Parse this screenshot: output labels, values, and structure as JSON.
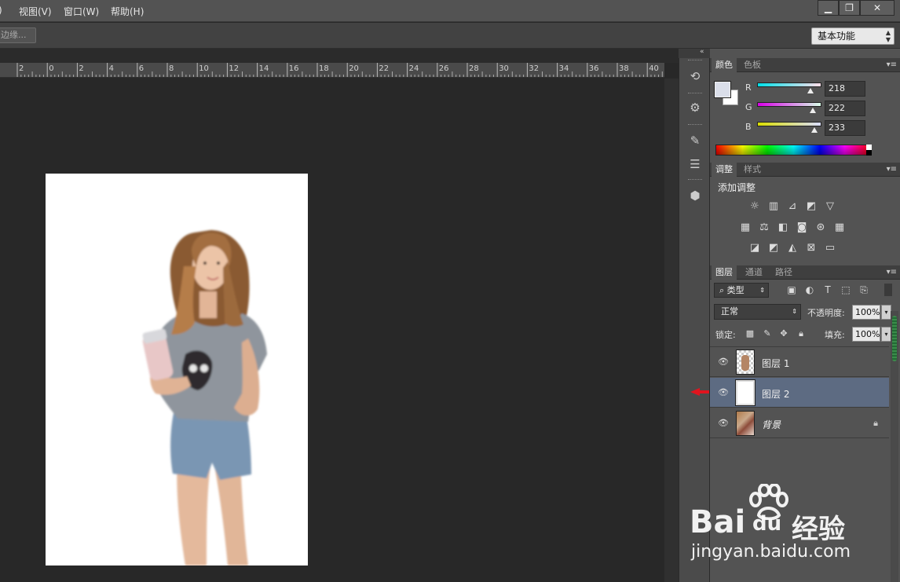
{
  "menu": {
    "items": [
      ")",
      "视图(V)",
      "窗口(W)",
      "帮助(H)"
    ],
    "window_buttons": [
      "minimize-icon",
      "restore-icon",
      "close-icon"
    ]
  },
  "options": {
    "edge_button": "边缘...",
    "workspace": "基本功能"
  },
  "ruler": {
    "labels": [
      "2",
      "0",
      "2",
      "4",
      "6",
      "8",
      "10",
      "12",
      "14",
      "16",
      "18",
      "20",
      "22",
      "24",
      "26",
      "28",
      "30",
      "32",
      "34",
      "36",
      "38",
      "40"
    ]
  },
  "color_panel": {
    "tabs": [
      "颜色",
      "色板"
    ],
    "r_label": "R",
    "g_label": "G",
    "b_label": "B",
    "r": "218",
    "g": "222",
    "b": "233",
    "foreground": "#dadee9",
    "background": "#ffffff"
  },
  "adjust_panel": {
    "tabs": [
      "调整",
      "样式"
    ],
    "title": "添加调整",
    "icons": [
      [
        "brightness-icon",
        "levels-icon",
        "curves-icon",
        "exposure-icon",
        "vibrance-icon"
      ],
      [
        "hue-saturation-icon",
        "color-balance-icon",
        "black-white-icon",
        "photo-filter-icon",
        "channel-mixer-icon",
        "color-lookup-icon"
      ],
      [
        "invert-icon",
        "posterize-icon",
        "threshold-icon",
        "selective-color-icon",
        "gradient-map-icon"
      ]
    ]
  },
  "layers_panel": {
    "tabs": [
      "图层",
      "通道",
      "路径"
    ],
    "kind": "类型",
    "blend_mode": "正常",
    "opacity_label": "不透明度:",
    "opacity": "100%",
    "lock_label": "锁定:",
    "fill_label": "填充:",
    "fill": "100%",
    "layers": [
      {
        "name": "图层 1",
        "selected": false
      },
      {
        "name": "图层 2",
        "selected": true
      },
      {
        "name": "背景",
        "selected": false,
        "locked": true
      }
    ]
  },
  "watermark": {
    "brand": "Bai",
    "brand2": "du",
    "suffix": "经验",
    "url": "jingyan.baidu.com"
  }
}
